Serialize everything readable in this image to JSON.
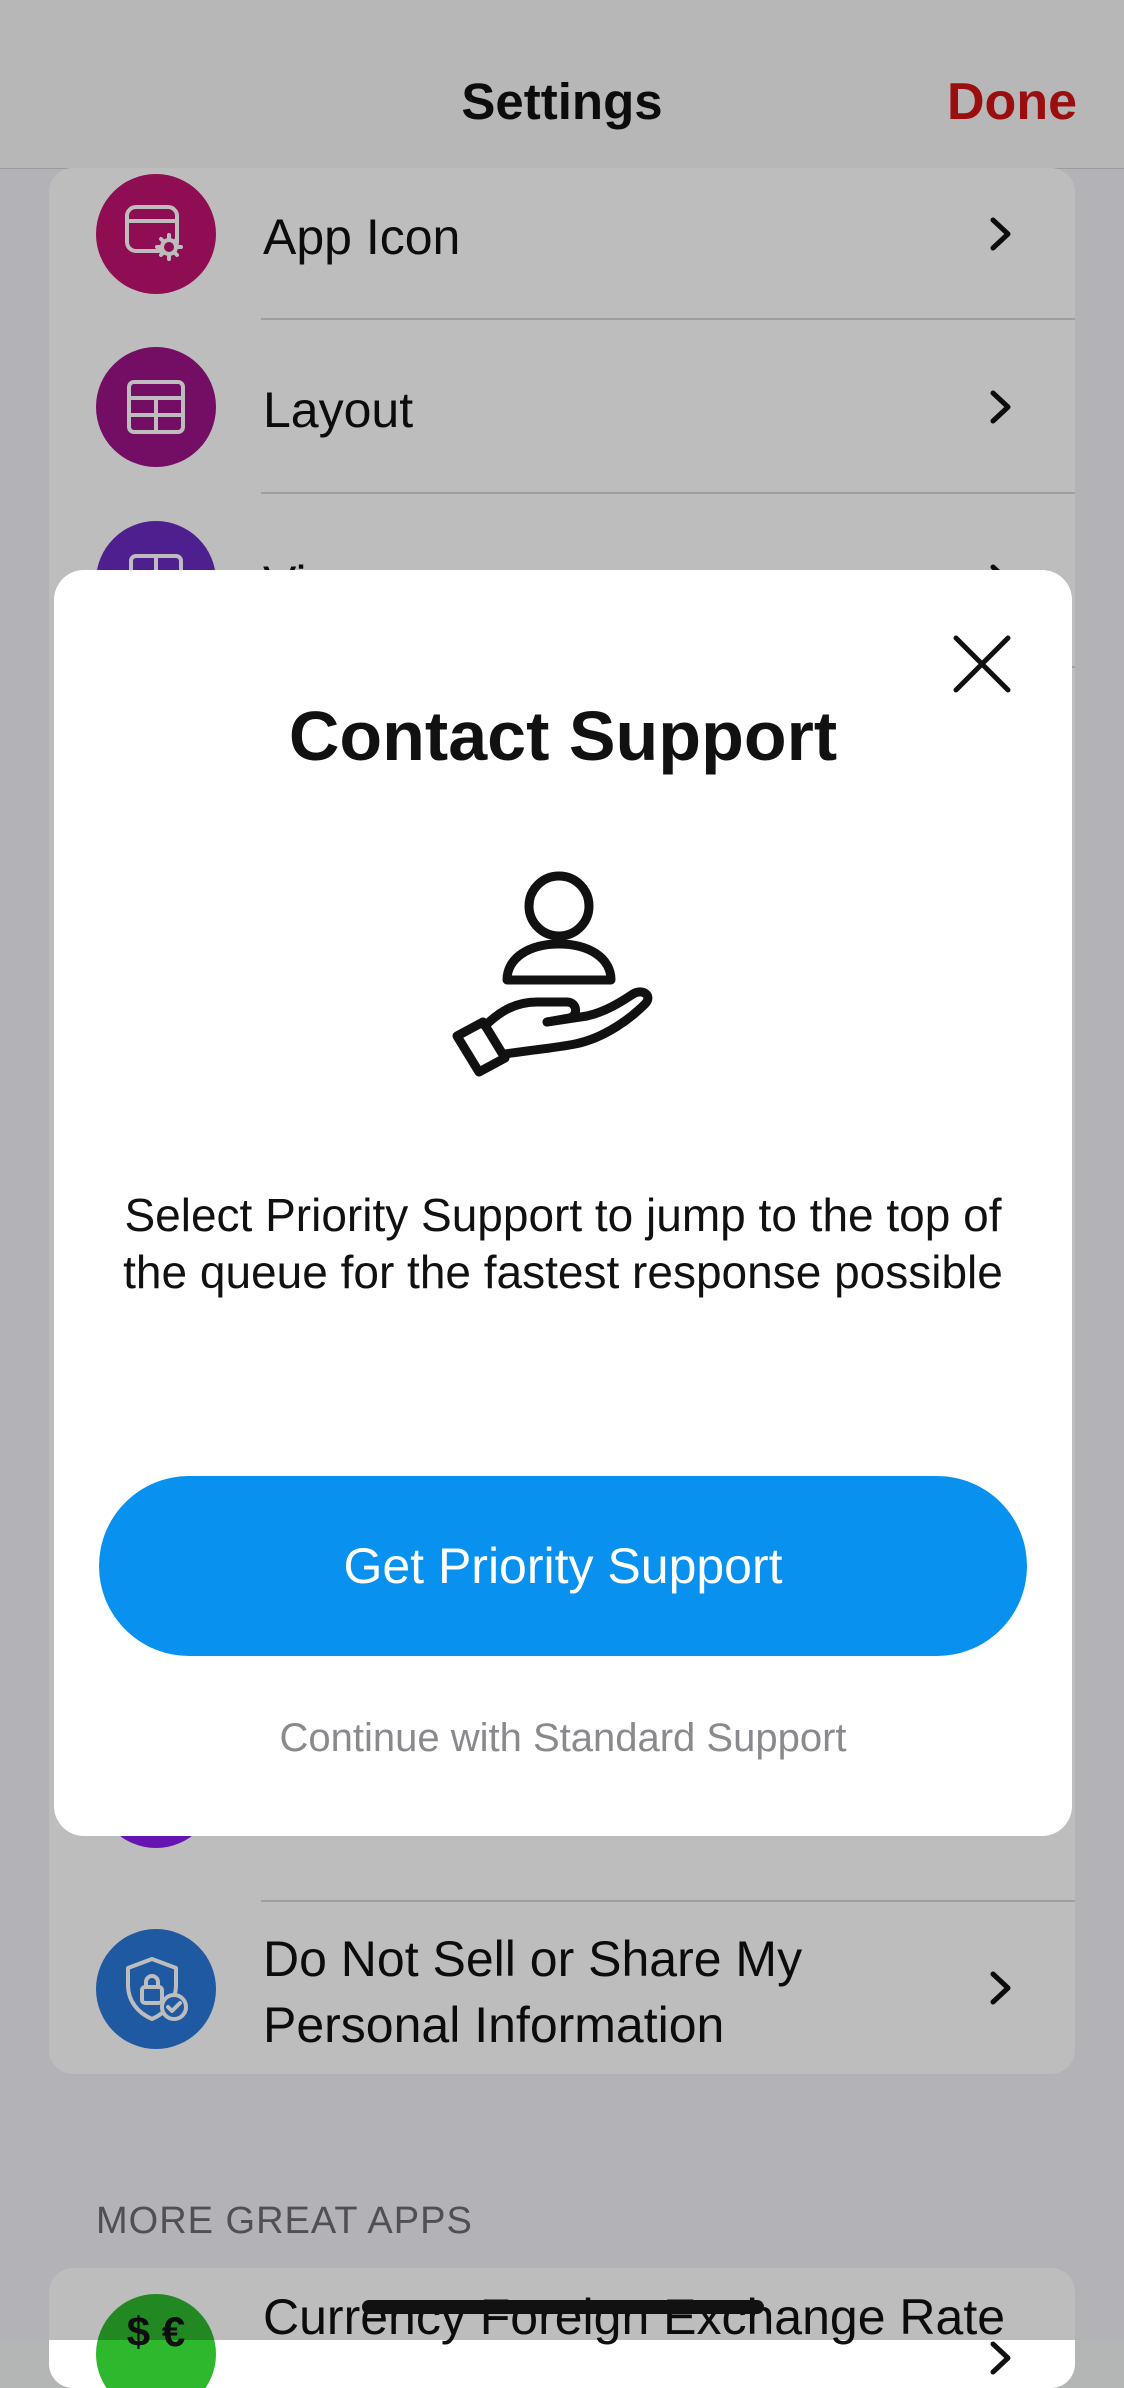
{
  "navbar": {
    "title": "Settings",
    "done_label": "Done"
  },
  "settings": {
    "rows": [
      {
        "label": "App Icon",
        "icon": "app-settings-icon",
        "color": "#c2126f"
      },
      {
        "label": "Layout",
        "icon": "table-layout-icon",
        "color": "#9d1389"
      },
      {
        "label": "Vi",
        "icon": "grid-view-icon",
        "color": "#6a2bc2"
      },
      {
        "label": "",
        "icon": "document-icon",
        "color": "#8b1df0"
      },
      {
        "label": "Do Not Sell or Share My Personal Information",
        "line1": "Do Not Sell or Share My",
        "line2": "Personal Information",
        "icon": "shield-lock-icon",
        "color": "#2a79da"
      }
    ],
    "more_apps_header": "MORE GREAT APPS",
    "more_apps": [
      {
        "label": "Currency Foreign Exchange Rate",
        "icon": "currency-exchange-icon",
        "color": "#2eb82e"
      }
    ]
  },
  "modal": {
    "title": "Contact Support",
    "illustration": "person-in-hand-icon",
    "message": "Select Priority Support to jump to the top of the queue for the fastest response possible",
    "primary_label": "Get Priority Support",
    "secondary_label": "Continue with Standard Support",
    "accent_color": "#0891ef"
  }
}
